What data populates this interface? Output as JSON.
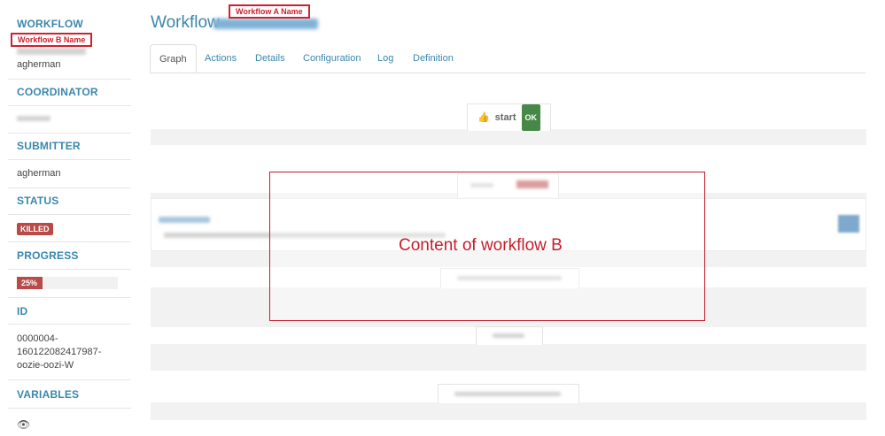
{
  "sidebar": {
    "workflow_heading": "WORKFLOW",
    "workflow_user": "agherman",
    "coordinator_heading": "COORDINATOR",
    "submitter_heading": "SUBMITTER",
    "submitter_value": "agherman",
    "status_heading": "STATUS",
    "status_value": "KILLED",
    "progress_heading": "PROGRESS",
    "progress_label": "25%",
    "progress_fraction": 0.25,
    "id_heading": "ID",
    "id_value": "0000004-160122082417987-oozie-oozi-W",
    "variables_heading": "VARIABLES"
  },
  "annotations": {
    "workflow_b_name": "Workflow B Name",
    "workflow_a_name": "Workflow A Name",
    "content_b": "Content of workflow B"
  },
  "header": {
    "title": "Workflow"
  },
  "tabs": [
    "Graph",
    "Actions",
    "Details",
    "Configuration",
    "Log",
    "Definition"
  ],
  "graph": {
    "start_label": "start",
    "start_status": "OK"
  },
  "colors": {
    "accent": "#3a87ad",
    "killed": "#b94a48",
    "ok": "#468847",
    "annotation": "#d0202f"
  }
}
